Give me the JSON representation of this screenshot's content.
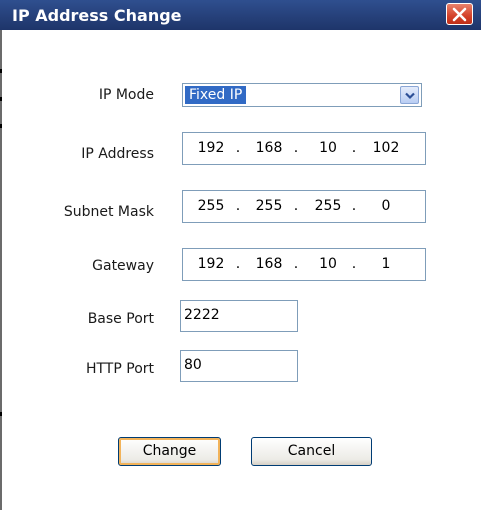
{
  "window": {
    "title": "IP Address Change",
    "close_icon": "close-icon",
    "accent_title": "#2a4785",
    "accent_close": "#d4422a"
  },
  "form": {
    "ip_mode": {
      "label": "IP Mode",
      "value": "Fixed IP"
    },
    "ip_address": {
      "label": "IP Address",
      "octets": [
        "192",
        "168",
        "10",
        "102"
      ]
    },
    "subnet_mask": {
      "label": "Subnet Mask",
      "octets": [
        "255",
        "255",
        "255",
        "0"
      ]
    },
    "gateway": {
      "label": "Gateway",
      "octets": [
        "192",
        "168",
        "10",
        "1"
      ]
    },
    "base_port": {
      "label": "Base Port",
      "value": "2222"
    },
    "http_port": {
      "label": "HTTP Port",
      "value": "80"
    }
  },
  "buttons": {
    "change": "Change",
    "cancel": "Cancel"
  }
}
